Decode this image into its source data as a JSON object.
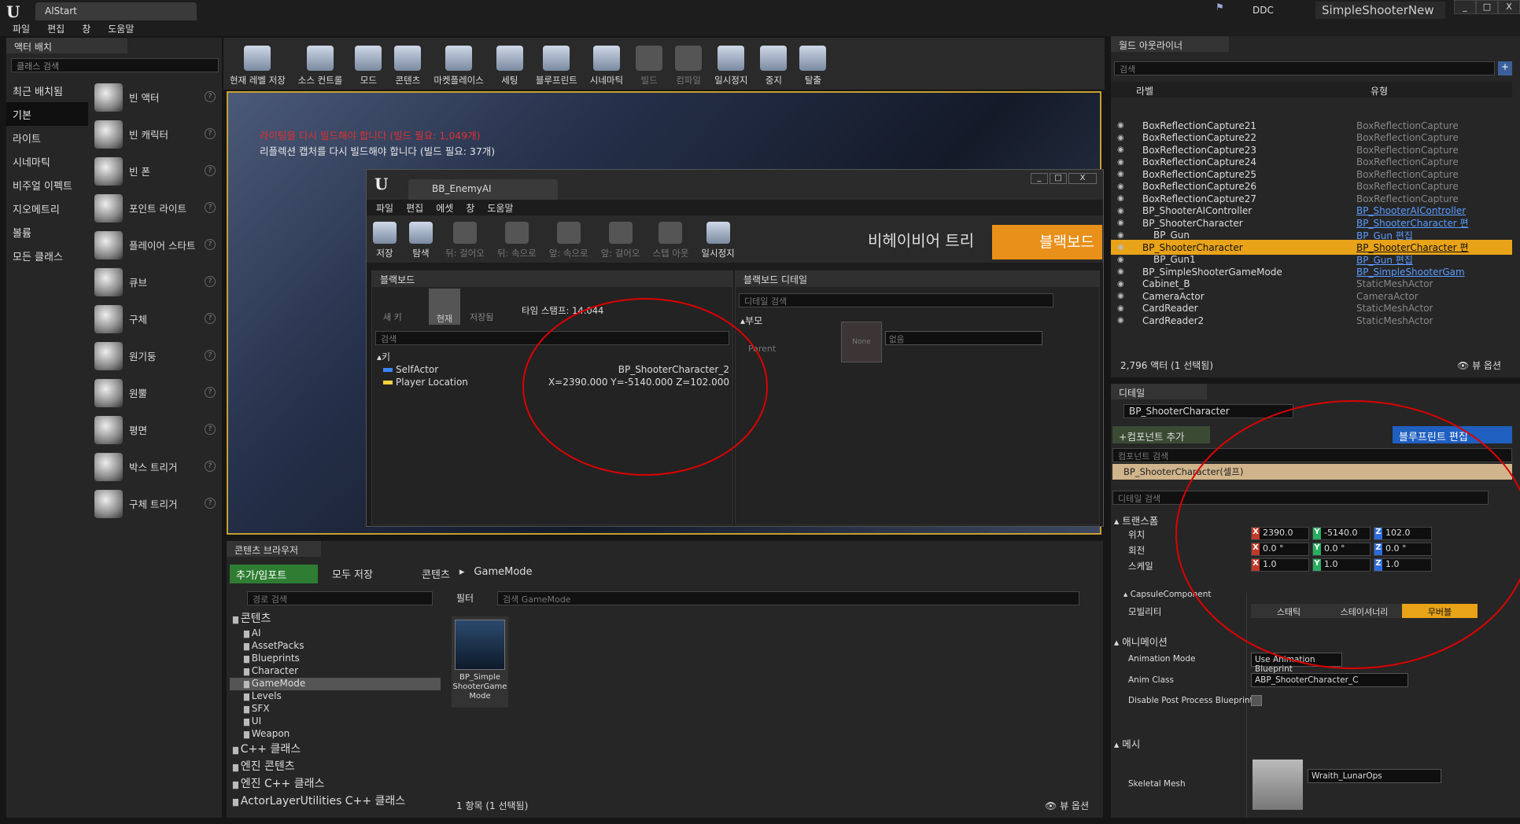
{
  "window": {
    "tab": "AlStart",
    "ddc": "DDC",
    "project": "SimpleShooterNew",
    "controls": [
      "_",
      "□",
      "X"
    ]
  },
  "menu": [
    "파일",
    "편집",
    "창",
    "도움말"
  ],
  "left": {
    "tab": "액터 배치",
    "search_placeholder": "클래스 검색",
    "categories": [
      "최근 배치됨",
      "기본",
      "라이트",
      "시네마틱",
      "비주얼 이펙트",
      "지오메트리",
      "볼륨",
      "모든 클래스"
    ],
    "items": [
      "빈 액터",
      "빈 캐릭터",
      "빈 폰",
      "포인트 라이트",
      "플레이어 스타트",
      "큐브",
      "구체",
      "원기둥",
      "원뿔",
      "평면",
      "박스 트리거",
      "구체 트리거"
    ]
  },
  "toolbar": [
    "현재 레벨 저장",
    "소스 컨트롤",
    "모드",
    "콘텐츠",
    "마켓플레이스",
    "세팅",
    "블루프린트",
    "시네마틱",
    "빌드",
    "컴파일",
    "일시정지",
    "중지",
    "탈출"
  ],
  "viewport": {
    "msg1": "라이팅을 다시 빌드해야 합니다 (빌드 필요: 1,049개)",
    "msg2": "리플렉션 캡처를 다시 빌드해야 합니다 (빌드 필요: 37개)"
  },
  "bt": {
    "tab": "BB_EnemyAI",
    "menu": [
      "파일",
      "편집",
      "에셋",
      "창",
      "도움말"
    ],
    "toolbar": [
      "저장",
      "탐색",
      "뒤: 걸어오",
      "뒤: 속으로",
      "앞: 속으로",
      "앞: 걸어오",
      "스텝 아웃",
      "일시정지"
    ],
    "bt_label": "비헤이비어 트리",
    "bb_label": "블랙보드",
    "bb": {
      "tab": "블랙보드",
      "newkey": "새 키",
      "current": "현재",
      "saved": "저장됨",
      "timestamp": "타임 스탬프: 14.044",
      "search_placeholder": "검색",
      "keys_header": "키",
      "rows": [
        {
          "name": "SelfActor",
          "value": "BP_ShooterCharacter_2",
          "color": "#3a86ff"
        },
        {
          "name": "Player Location",
          "value": "X=2390.000 Y=-5140.000 Z=102.000",
          "color": "#f4d03f"
        }
      ]
    },
    "bbd": {
      "tab": "블랙보드 디테일",
      "search_placeholder": "디테일 검색",
      "parent_section": "부모",
      "parent_label": "Parent",
      "none": "None",
      "none_dd": "없음"
    }
  },
  "outliner": {
    "tab": "월드 아웃라이너",
    "search_placeholder": "검색",
    "col_label": "라벨",
    "col_type": "유형",
    "rows": [
      {
        "label": "BoxReflectionCapture21",
        "type": "BoxReflectionCapture",
        "link": false,
        "indent": 0
      },
      {
        "label": "BoxReflectionCapture22",
        "type": "BoxReflectionCapture",
        "link": false,
        "indent": 0
      },
      {
        "label": "BoxReflectionCapture23",
        "type": "BoxReflectionCapture",
        "link": false,
        "indent": 0
      },
      {
        "label": "BoxReflectionCapture24",
        "type": "BoxReflectionCapture",
        "link": false,
        "indent": 0
      },
      {
        "label": "BoxReflectionCapture25",
        "type": "BoxReflectionCapture",
        "link": false,
        "indent": 0
      },
      {
        "label": "BoxReflectionCapture26",
        "type": "BoxReflectionCapture",
        "link": false,
        "indent": 0
      },
      {
        "label": "BoxReflectionCapture27",
        "type": "BoxReflectionCapture",
        "link": false,
        "indent": 0
      },
      {
        "label": "BP_ShooterAIController",
        "type": "BP_ShooterAIController",
        "link": true,
        "indent": 0
      },
      {
        "label": "BP_ShooterCharacter",
        "type": "BP_ShooterCharacter 편",
        "link": true,
        "indent": 0
      },
      {
        "label": "BP_Gun",
        "type": "BP_Gun 편집",
        "link": true,
        "indent": 1
      },
      {
        "label": "BP_ShooterCharacter",
        "type": "BP_ShooterCharacter 편",
        "link": true,
        "indent": 0,
        "sel": true
      },
      {
        "label": "BP_Gun1",
        "type": "BP_Gun 편집",
        "link": true,
        "indent": 1
      },
      {
        "label": "BP_SimpleShooterGameMode",
        "type": "BP_SimpleShooterGam",
        "link": true,
        "indent": 0
      },
      {
        "label": "Cabinet_B",
        "type": "StaticMeshActor",
        "link": false,
        "indent": 0
      },
      {
        "label": "CameraActor",
        "type": "CameraActor",
        "link": false,
        "indent": 0
      },
      {
        "label": "CardReader",
        "type": "StaticMeshActor",
        "link": false,
        "indent": 0
      },
      {
        "label": "CardReader2",
        "type": "StaticMeshActor",
        "link": false,
        "indent": 0
      }
    ],
    "footer": "2,796 액터 (1 선택됨)",
    "view_options": "뷰 옵션"
  },
  "details": {
    "tab": "디테일",
    "name": "BP_ShooterCharacter",
    "add_component": "+컴포넌트 추가",
    "bp_edit": "블루프린트 편집",
    "comp_search_placeholder": "컴포넌트 검색",
    "self_row": "BP_ShooterCharacter(셀프)",
    "detail_search_placeholder": "디테일 검색",
    "transform": "트랜스폼",
    "location": "위치",
    "rotation": "회전",
    "scale": "스케일",
    "loc": [
      "2390.0",
      "-5140.0",
      "102.0"
    ],
    "rot": [
      "0.0 °",
      "0.0 °",
      "0.0 °"
    ],
    "scl": [
      "1.0",
      "1.0",
      "1.0"
    ],
    "capsule": "CapsuleComponent",
    "mobility": "모빌리티",
    "mob_options": [
      "스태틱",
      "스테이셔너리",
      "무버블"
    ],
    "animation": "애니메이션",
    "anim_mode_label": "Animation Mode",
    "anim_mode": "Use Animation Blueprint",
    "anim_class_label": "Anim Class",
    "anim_class": "ABP_ShooterCharacter_C",
    "disable_pp_label": "Disable Post Process Blueprint",
    "mesh": "메시",
    "skeletal_mesh_label": "Skeletal Mesh",
    "skeletal_mesh": "Wraith_LunarOps"
  },
  "cb": {
    "tab": "콘텐츠 브라우저",
    "add": "추가/임포트",
    "save_all": "모두 저장",
    "crumbs": [
      "콘텐츠",
      "GameMode"
    ],
    "path_search_placeholder": "경로 검색",
    "filter": "필터",
    "asset_search_placeholder": "검색 GameMode",
    "tree": [
      {
        "t": "콘텐츠",
        "lvl": 0,
        "big": true
      },
      {
        "t": "AI",
        "lvl": 1
      },
      {
        "t": "AssetPacks",
        "lvl": 1
      },
      {
        "t": "Blueprints",
        "lvl": 1
      },
      {
        "t": "Character",
        "lvl": 1
      },
      {
        "t": "GameMode",
        "lvl": 1,
        "sel": true
      },
      {
        "t": "Levels",
        "lvl": 1
      },
      {
        "t": "SFX",
        "lvl": 1
      },
      {
        "t": "UI",
        "lvl": 1
      },
      {
        "t": "Weapon",
        "lvl": 1
      },
      {
        "t": "C++ 클래스",
        "lvl": 0,
        "big": true
      },
      {
        "t": "엔진 콘텐츠",
        "lvl": 0,
        "big": true
      },
      {
        "t": "엔진 C++ 클래스",
        "lvl": 0,
        "big": true
      },
      {
        "t": "ActorLayerUtilities C++ 클래스",
        "lvl": 0,
        "big": true
      }
    ],
    "asset": "BP_Simple ShooterGame Mode",
    "footer": "1 항목 (1 선택됨)",
    "view_options": "뷰 옵션"
  }
}
